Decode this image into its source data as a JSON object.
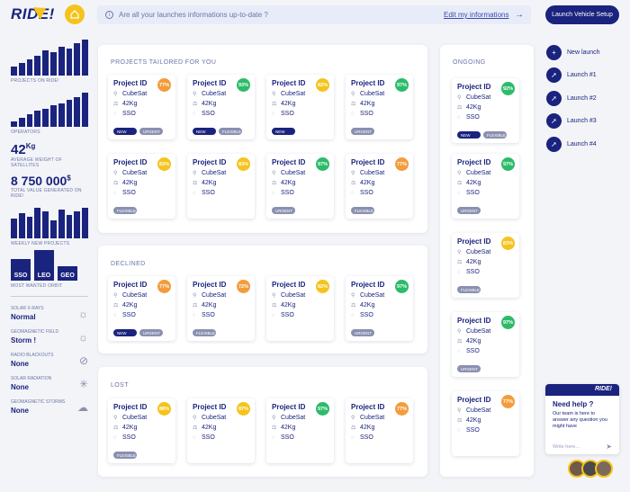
{
  "brand": {
    "logo": "RIDE!"
  },
  "banner": {
    "question": "Are all your launches informations up-to-date ?",
    "edit_link": "Edit my informations",
    "arrow": "→"
  },
  "setup_button": "Launch Vehicle Setup",
  "sidebar": {
    "projects_label": "PROJECTS ON RIDE!",
    "operators_label": "OPERATORS",
    "avg_weight_value": "42",
    "avg_weight_unit": "Kg",
    "avg_weight_label": "AVERAGE WEIGHT OF SATELLITES",
    "total_value": "8 750 000",
    "total_value_unit": "$",
    "total_value_label": "TOTAL VALUE GENERATED ON RIDE!",
    "weekly_label": "WEEKLY NEW PROJECTS",
    "orbits": [
      "SSO",
      "LEO",
      "GEO"
    ],
    "orbit_label": "MOST WANTED ORBIT",
    "weather": [
      {
        "label": "SOLAR X-RAYS",
        "value": "Normal",
        "icon": "sun-icon"
      },
      {
        "label": "GEOMAGNETIC FIELD",
        "value": "Storm !",
        "icon": "sun-icon"
      },
      {
        "label": "RADIO BLACKOUTS",
        "value": "None",
        "icon": "signal-off-icon"
      },
      {
        "label": "SOLAR RADIATION",
        "value": "None",
        "icon": "sun-dotted-icon"
      },
      {
        "label": "GEOMAGNETIC STORMS",
        "value": "None",
        "icon": "cloud-storm-icon"
      }
    ]
  },
  "sections": {
    "tailored": "PROJECTS TAILORED FOR YOU",
    "declined": "DECLINED",
    "lost": "LOST",
    "ongoing": "ONGOING"
  },
  "card_common": {
    "title": "Project ID",
    "type": "CubeSat",
    "weight": "42Kg",
    "orbit": "SSO"
  },
  "tailored_cards": [
    {
      "score": "77%",
      "color": "#f39c3c",
      "tags": [
        "NEW",
        "URGENT"
      ]
    },
    {
      "score": "93%",
      "color": "#2dbb6a",
      "tags": [
        "NEW",
        "FLEXIBLE"
      ]
    },
    {
      "score": "82%",
      "color": "#f5c31d",
      "tags": [
        "NEW"
      ]
    },
    {
      "score": "97%",
      "color": "#2dbb6a",
      "tags": [
        "URGENT"
      ]
    },
    {
      "score": "83%",
      "color": "#f5c31d",
      "tags": [
        "FLEXIBLE"
      ]
    },
    {
      "score": "83%",
      "color": "#f5c31d",
      "tags": []
    },
    {
      "score": "97%",
      "color": "#2dbb6a",
      "tags": [
        "URGENT"
      ]
    },
    {
      "score": "77%",
      "color": "#f39c3c",
      "tags": [
        "FLEXIBLE"
      ]
    }
  ],
  "declined_cards": [
    {
      "score": "77%",
      "color": "#f39c3c",
      "tags": [
        "NEW",
        "URGENT"
      ]
    },
    {
      "score": "72%",
      "color": "#f39c3c",
      "tags": [
        "FLEXIBLE"
      ]
    },
    {
      "score": "82%",
      "color": "#f5c31d",
      "tags": []
    },
    {
      "score": "97%",
      "color": "#2dbb6a",
      "tags": [
        "URGENT"
      ]
    }
  ],
  "lost_cards": [
    {
      "score": "88%",
      "color": "#f5c31d",
      "tags": [
        "FLEXIBLE"
      ]
    },
    {
      "score": "87%",
      "color": "#f5c31d",
      "tags": []
    },
    {
      "score": "97%",
      "color": "#2dbb6a",
      "tags": []
    },
    {
      "score": "77%",
      "color": "#f39c3c",
      "tags": []
    }
  ],
  "ongoing_cards": [
    {
      "score": "92%",
      "color": "#2dbb6a",
      "tags": [
        "NEW",
        "FLEXIBLE"
      ]
    },
    {
      "score": "97%",
      "color": "#2dbb6a",
      "tags": [
        "URGENT"
      ]
    },
    {
      "score": "83%",
      "color": "#f5c31d",
      "tags": [
        "FLEXIBLE"
      ]
    },
    {
      "score": "97%",
      "color": "#2dbb6a",
      "tags": [
        "URGENT"
      ]
    },
    {
      "score": "77%",
      "color": "#f39c3c",
      "tags": []
    }
  ],
  "tag_colors": {
    "NEW": "#1a237e",
    "URGENT": "#8a90b0",
    "FLEXIBLE": "#8a90b0"
  },
  "launches": {
    "new": "New launch",
    "items": [
      "Launch #1",
      "Launch #2",
      "Launch #3",
      "Launch #4"
    ]
  },
  "help": {
    "brand": "RIDE!",
    "title": "Need help ?",
    "body": "Our team is here to answer any question you might have",
    "placeholder": "Write here..."
  }
}
